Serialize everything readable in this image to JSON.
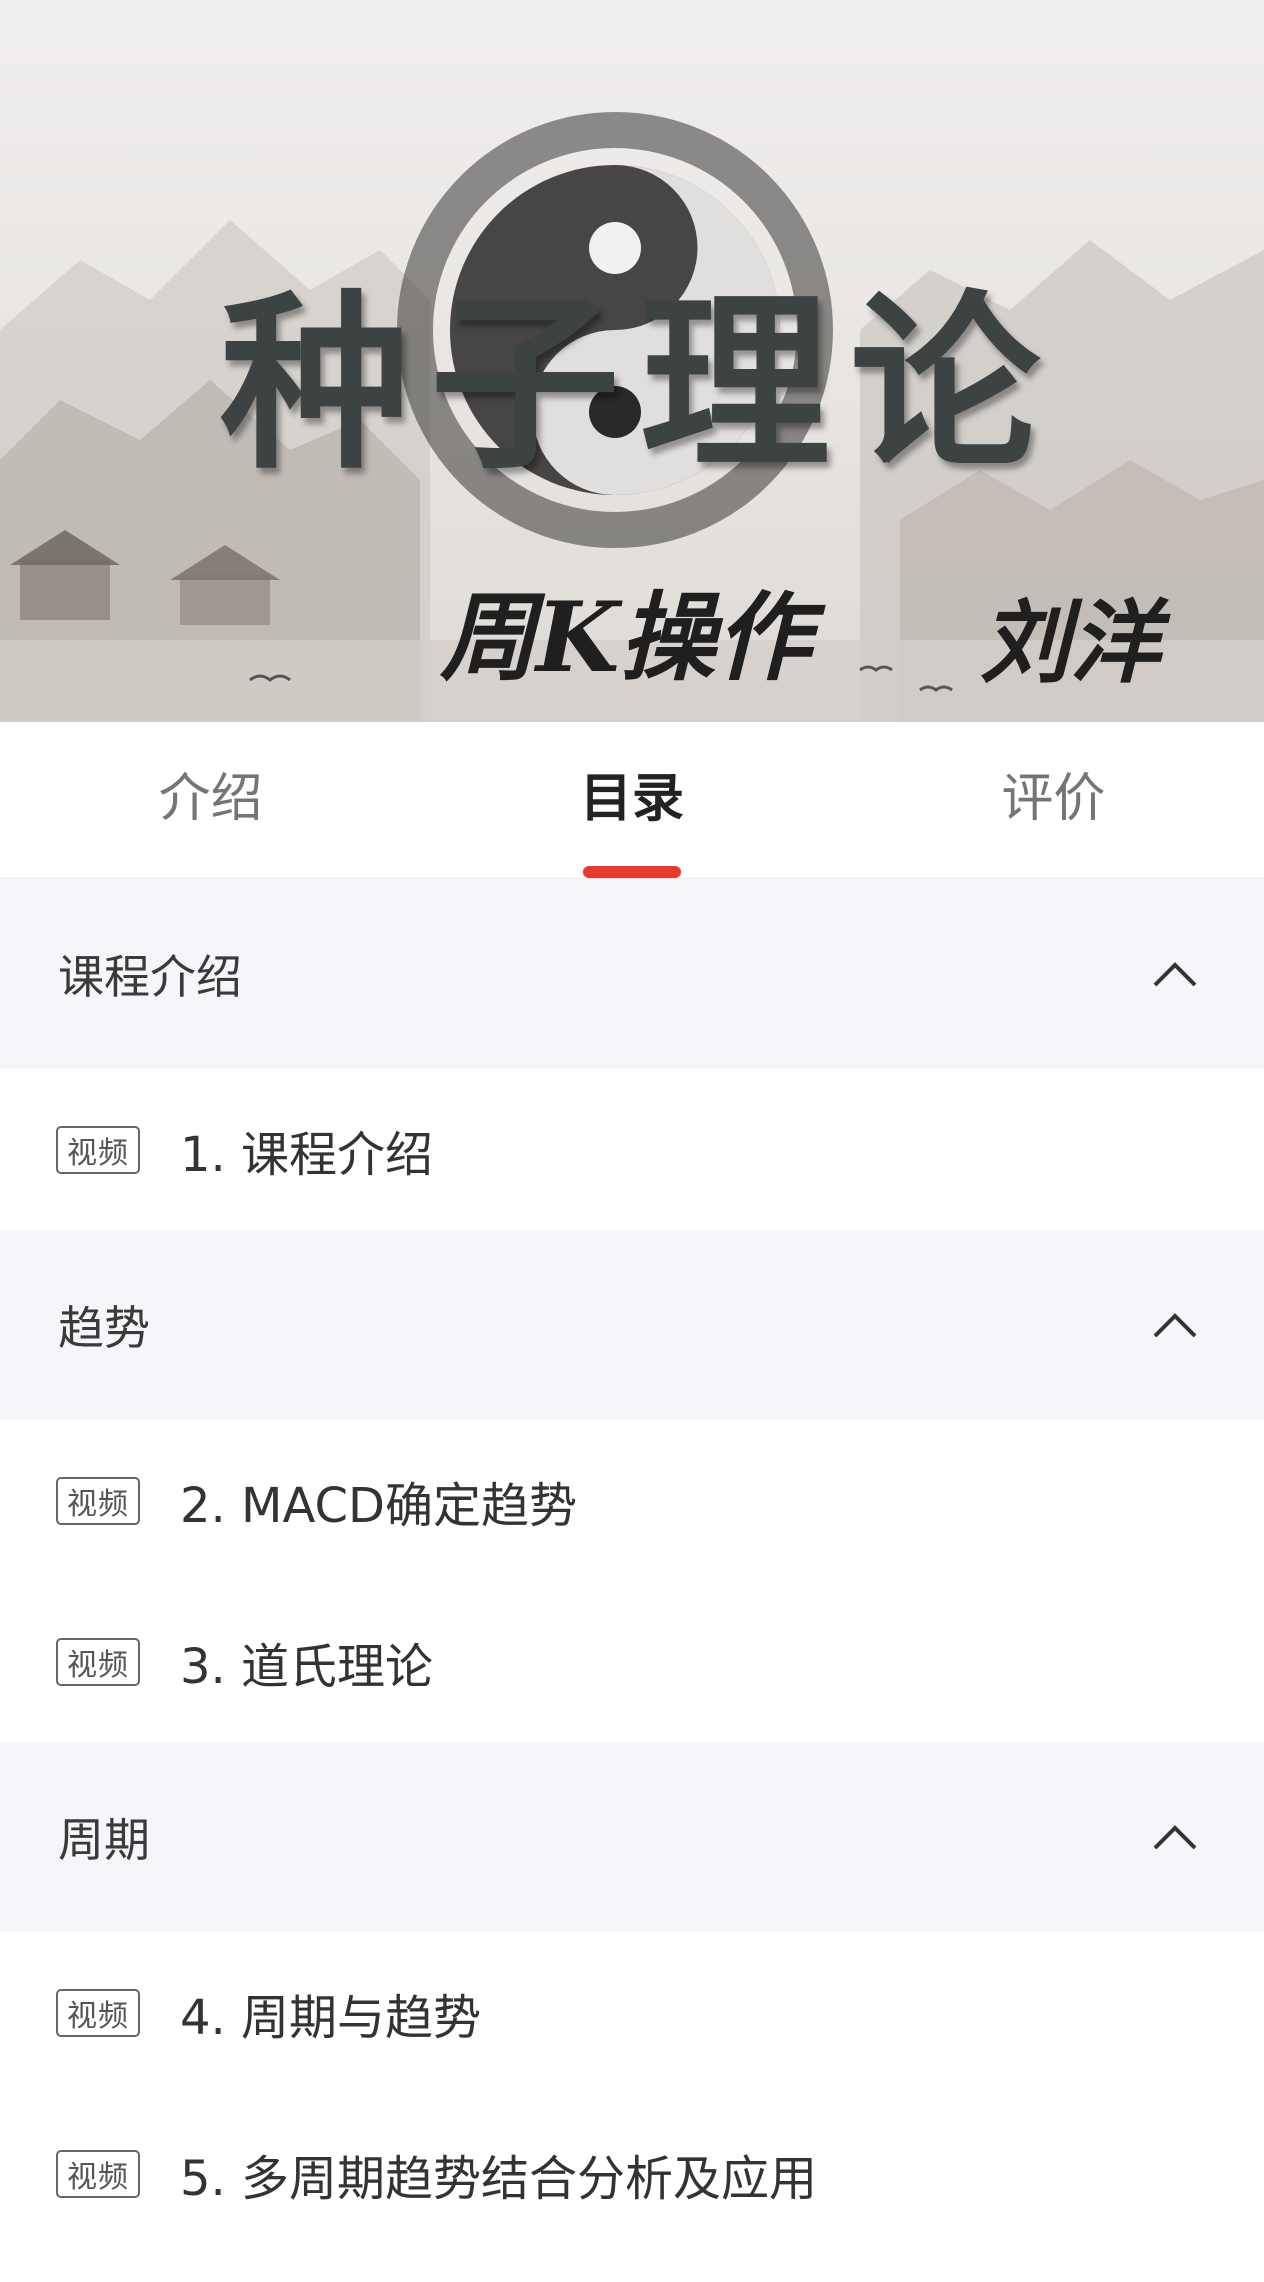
{
  "banner": {
    "title": "种子理论",
    "subtitle": "周K操作",
    "author": "刘洋"
  },
  "tabs": [
    {
      "label": "介绍",
      "active": false
    },
    {
      "label": "目录",
      "active": true
    },
    {
      "label": "评价",
      "active": false
    }
  ],
  "accent_color": "#e8392b",
  "sections": [
    {
      "title": "课程介绍",
      "lessons": [
        {
          "badge": "视频",
          "title": "1. 课程介绍"
        }
      ]
    },
    {
      "title": "趋势",
      "lessons": [
        {
          "badge": "视频",
          "title": "2. MACD确定趋势"
        },
        {
          "badge": "视频",
          "title": "3. 道氏理论"
        }
      ]
    },
    {
      "title": "周期",
      "lessons": [
        {
          "badge": "视频",
          "title": "4. 周期与趋势"
        },
        {
          "badge": "视频",
          "title": "5. 多周期趋势结合分析及应用"
        }
      ]
    }
  ]
}
